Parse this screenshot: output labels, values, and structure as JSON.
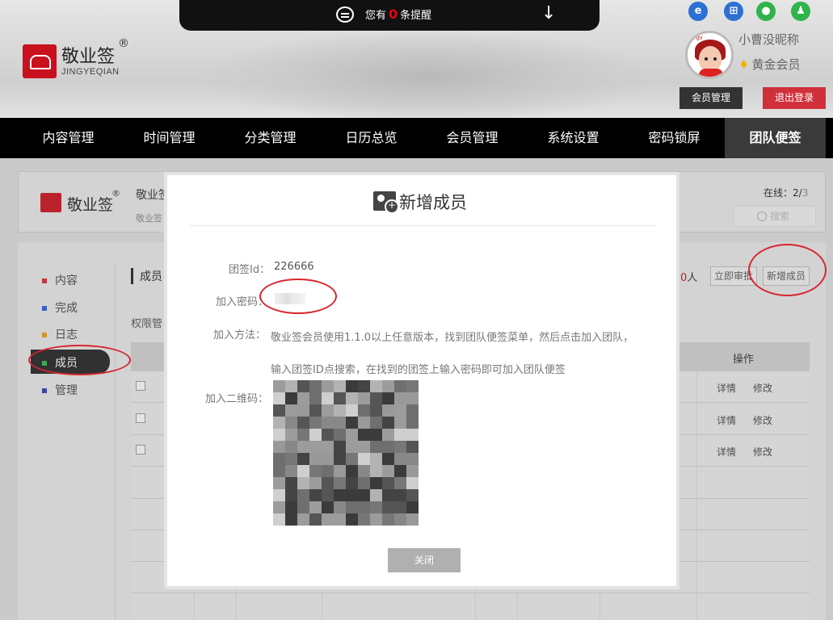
{
  "notice": {
    "prefix": "您有",
    "count": "0",
    "suffix": "条提醒"
  },
  "logo": {
    "name": "敬业签",
    "sub": "JINGYEQIAN",
    "reg": "®"
  },
  "user": {
    "nickname": "小曹没昵称",
    "level": "黄金会员",
    "avatar_tag": "Pipi"
  },
  "header_buttons": {
    "member": "会员管理",
    "logout": "退出登录"
  },
  "nav": [
    "内容管理",
    "时间管理",
    "分类管理",
    "日历总览",
    "会员管理",
    "系统设置",
    "密码锁屏",
    "团队便签"
  ],
  "team_panel": {
    "logo_name": "敬业签",
    "team_name": "敬业签",
    "team_sub": "敬业签",
    "online_label": "在线：",
    "online_value": "2/",
    "online_total": "3",
    "search_placeholder": "搜索"
  },
  "sidebar": [
    {
      "label": "内容",
      "color": "#d8262f"
    },
    {
      "label": "完成",
      "color": "#2a5bd7"
    },
    {
      "label": "日志",
      "color": "#e39a1c"
    },
    {
      "label": "成员",
      "color": "#2fb34a"
    },
    {
      "label": "管理",
      "color": "#2a3fb0"
    }
  ],
  "members": {
    "section_title": "成员",
    "perm_label": "权限管",
    "count": "0",
    "count_unit": "人",
    "approve_btn": "立即审批",
    "add_btn": "新增成员",
    "ops_header": "操作",
    "rows": [
      {
        "detail": "详情",
        "edit": "修改"
      },
      {
        "detail": "详情",
        "edit": "修改"
      },
      {
        "detail": "详情",
        "edit": "修改"
      }
    ]
  },
  "modal": {
    "title": "新增成员",
    "team_id_label": "团签Id：",
    "team_id": "226666",
    "password_label": "加入密码：",
    "method_label": "加入方法：",
    "method_text": "敬业签会员使用1.1.0以上任意版本，找到团队便签菜单，然后点击加入团队，输入团签ID点搜索，在找到的团签上输入密码即可加入团队便签",
    "qr_label": "加入二维码：",
    "close_btn": "关闭"
  },
  "colors": {
    "brand_red": "#c8101e",
    "nav_bg": "#000000",
    "logout_red": "#d0303a",
    "highlight_ring": "#d8262f"
  }
}
